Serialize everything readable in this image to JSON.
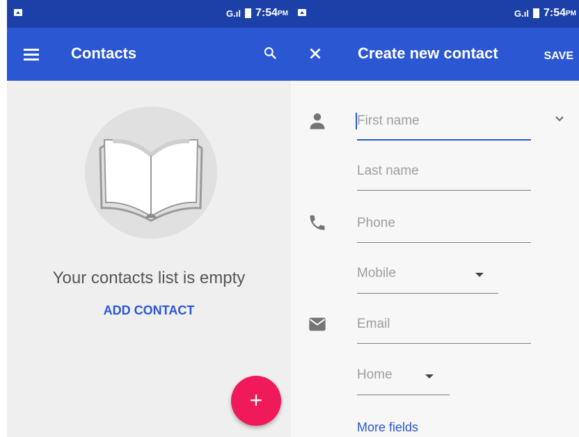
{
  "status_bar": {
    "signal": "G.ıl",
    "time": "7:54",
    "ampm": "PM"
  },
  "contacts_screen": {
    "title": "Contacts",
    "empty_message": "Your contacts list is empty",
    "add_contact_label": "ADD CONTACT",
    "fab_label": "+"
  },
  "create_contact_screen": {
    "title": "Create new contact",
    "save_label": "SAVE",
    "fields": {
      "first_name": {
        "placeholder": "First name",
        "value": ""
      },
      "last_name": {
        "placeholder": "Last name",
        "value": ""
      },
      "phone": {
        "placeholder": "Phone",
        "value": ""
      },
      "phone_type": "Mobile",
      "email": {
        "placeholder": "Email",
        "value": ""
      },
      "email_type": "Home"
    },
    "more_fields_label": "More fields"
  },
  "colors": {
    "status_bar": "#1d40a8",
    "app_bar": "#2b57d3",
    "accent": "#2b57d3",
    "fab": "#f0195a"
  },
  "icons": [
    "image-icon",
    "signal-icon",
    "battery-icon",
    "menu-icon",
    "search-icon",
    "book-icon",
    "add-icon",
    "close-icon",
    "person-icon",
    "chevron-down-icon",
    "phone-icon",
    "email-icon",
    "dropdown-arrow-icon"
  ]
}
